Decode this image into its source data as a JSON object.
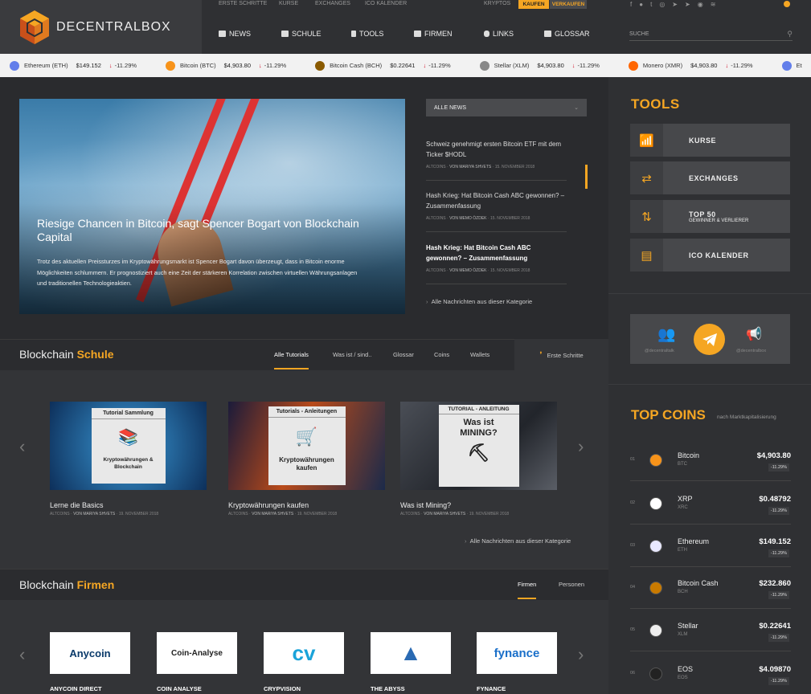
{
  "brand": {
    "name": "DECENTRALBOX"
  },
  "toplinks": [
    "ERSTE SCHRITTE",
    "KURSE",
    "EXCHANGES",
    "ICO KALENDER"
  ],
  "toplinks_right": {
    "label": "KRYPTOS",
    "buy": "KAUFEN",
    "sell": "VERKAUFEN"
  },
  "nav": [
    "NEWS",
    "SCHULE",
    "TOOLS",
    "FIRMEN",
    "LINKS",
    "GLOSSAR"
  ],
  "search": {
    "placeholder": "SUCHE"
  },
  "ticker": [
    {
      "name": "Ethereum (ETH)",
      "price": "$149.152",
      "change": "-11.29%",
      "color": "#627eea"
    },
    {
      "name": "Bitcoin (BTC)",
      "price": "$4,903.80",
      "change": "-11.29%",
      "color": "#f7931a"
    },
    {
      "name": "Bitcoin Cash (BCH)",
      "price": "$0.22641",
      "change": "-11.29%",
      "color": "#8a5a00"
    },
    {
      "name": "Stellar (XLM)",
      "price": "$4,903.80",
      "change": "-11.29%",
      "color": "#888888"
    },
    {
      "name": "Monero (XMR)",
      "price": "$4,903.80",
      "change": "-11.29%",
      "color": "#ff6600"
    },
    {
      "name": "Et",
      "price": "",
      "change": "",
      "color": "#627eea"
    }
  ],
  "hero": {
    "title": "Riesige Chancen in Bitcoin, sagt Spencer Bogart von Blockchain Capital",
    "desc": "Trotz des aktuellen Preissturzes im Kryptowährungsmarkt ist Spencer Bogart davon überzeugt, dass in Bitcoin enorme Möglichkeiten schlummern. Er prognostiziert auch eine Zeit der stärkeren Korrelation zwischen virtuellen Währungsanlagen und traditionellen Technologieaktien."
  },
  "news": {
    "select": "ALLE NEWS",
    "items": [
      {
        "title": "Schweiz genehmigt ersten Bitcoin ETF mit dem Ticker $HODL",
        "cat": "ALTCOINS",
        "author": "VON MARIYA SHVETS",
        "date": "15. NOVEMBER 2018"
      },
      {
        "title": "Hash Krieg: Hat Bitcoin Cash ABC gewonnen? – Zusammenfassung",
        "cat": "ALTCOINS",
        "author": "VON MEMO ÖZDEK",
        "date": "15. NOVEMBER 2018"
      },
      {
        "title": "Hash Krieg: Hat Bitcoin Cash ABC gewonnen? – Zusammenfassung",
        "cat": "ALTCOINS",
        "author": "VON MEMO ÖZDEK",
        "date": "15. NOVEMBER 2018"
      }
    ],
    "more": "Alle Nachrichten aus dieser Kategorie"
  },
  "tools": {
    "title": "TOOLS",
    "items": [
      {
        "label": "KURSE",
        "sub": ""
      },
      {
        "label": "EXCHANGES",
        "sub": ""
      },
      {
        "label": "TOP 50",
        "sub": "GEWINNER & VERLIERER"
      },
      {
        "label": "ICO KALENDER",
        "sub": ""
      }
    ]
  },
  "social": {
    "left": "@decentraltalk",
    "right": "@decentralbox"
  },
  "topcoins": {
    "title": "TOP COINS",
    "sub": "nach Marktkapitalisierung",
    "items": [
      {
        "rank": "01",
        "name": "Bitcoin",
        "sym": "BTC",
        "price": "$4,903.80",
        "change": "-11.29%",
        "color": "#f7931a"
      },
      {
        "rank": "02",
        "name": "XRP",
        "sym": "XRC",
        "price": "$0.48792",
        "change": "-11.29%",
        "color": "#ffffff"
      },
      {
        "rank": "03",
        "name": "Ethereum",
        "sym": "ETH",
        "price": "$149.152",
        "change": "-11.29%",
        "color": "#e8e8ff"
      },
      {
        "rank": "04",
        "name": "Bitcoin Cash",
        "sym": "BCH",
        "price": "$232.860",
        "change": "-11.29%",
        "color": "#c97a00"
      },
      {
        "rank": "05",
        "name": "Stellar",
        "sym": "XLM",
        "price": "$0.22641",
        "change": "-11.29%",
        "color": "#eeeeee"
      },
      {
        "rank": "06",
        "name": "EOS",
        "sym": "EOS",
        "price": "$4.09870",
        "change": "-11.29%",
        "color": "#222222"
      }
    ]
  },
  "school": {
    "title_a": "Blockchain ",
    "title_b": "Schule",
    "tabs": [
      "Alle Tutorials",
      "Was ist / sind..",
      "Glossar",
      "Coins",
      "Wallets"
    ],
    "first_steps": "Erste Schritte",
    "cards": [
      {
        "title": "Lerne die Basics",
        "poster_top": "Tutorial Sammlung",
        "poster_bottom": "Kryptowährungen & Blockchain",
        "cat": "ALTCOINS",
        "author": "VON MARIYA SHVETS",
        "date": "19. NOVEMBER 2018"
      },
      {
        "title": "Kryptowährungen kaufen",
        "poster_top": "Tutorials - Anleitungen",
        "poster_bottom": "Kryptowährungen kaufen",
        "cat": "ALTCOINS",
        "author": "VON MARIYA SHVETS",
        "date": "19. NOVEMBER 2018"
      },
      {
        "title": "Was ist Mining?",
        "poster_top": "TUTORIAL - ANLEITUNG",
        "poster_bottom": "Was ist MINING?",
        "cat": "ALTCOINS",
        "author": "VON MARIYA SHVETS",
        "date": "19. NOVEMBER 2018"
      }
    ],
    "more": "Alle Nachrichten aus dieser Kategorie"
  },
  "firms": {
    "title_a": "Blockchain ",
    "title_b": "Firmen",
    "tabs": [
      "Firmen",
      "Personen"
    ],
    "items": [
      {
        "name": "ANYCOIN DIRECT",
        "logo": "Anycoin"
      },
      {
        "name": "COIN ANALYSE",
        "logo": "Coin-Analyse"
      },
      {
        "name": "CRYPVISION",
        "logo": "cv"
      },
      {
        "name": "THE ABYSS",
        "logo": "▲"
      },
      {
        "name": "FYNANCE",
        "logo": "fynance"
      }
    ]
  }
}
